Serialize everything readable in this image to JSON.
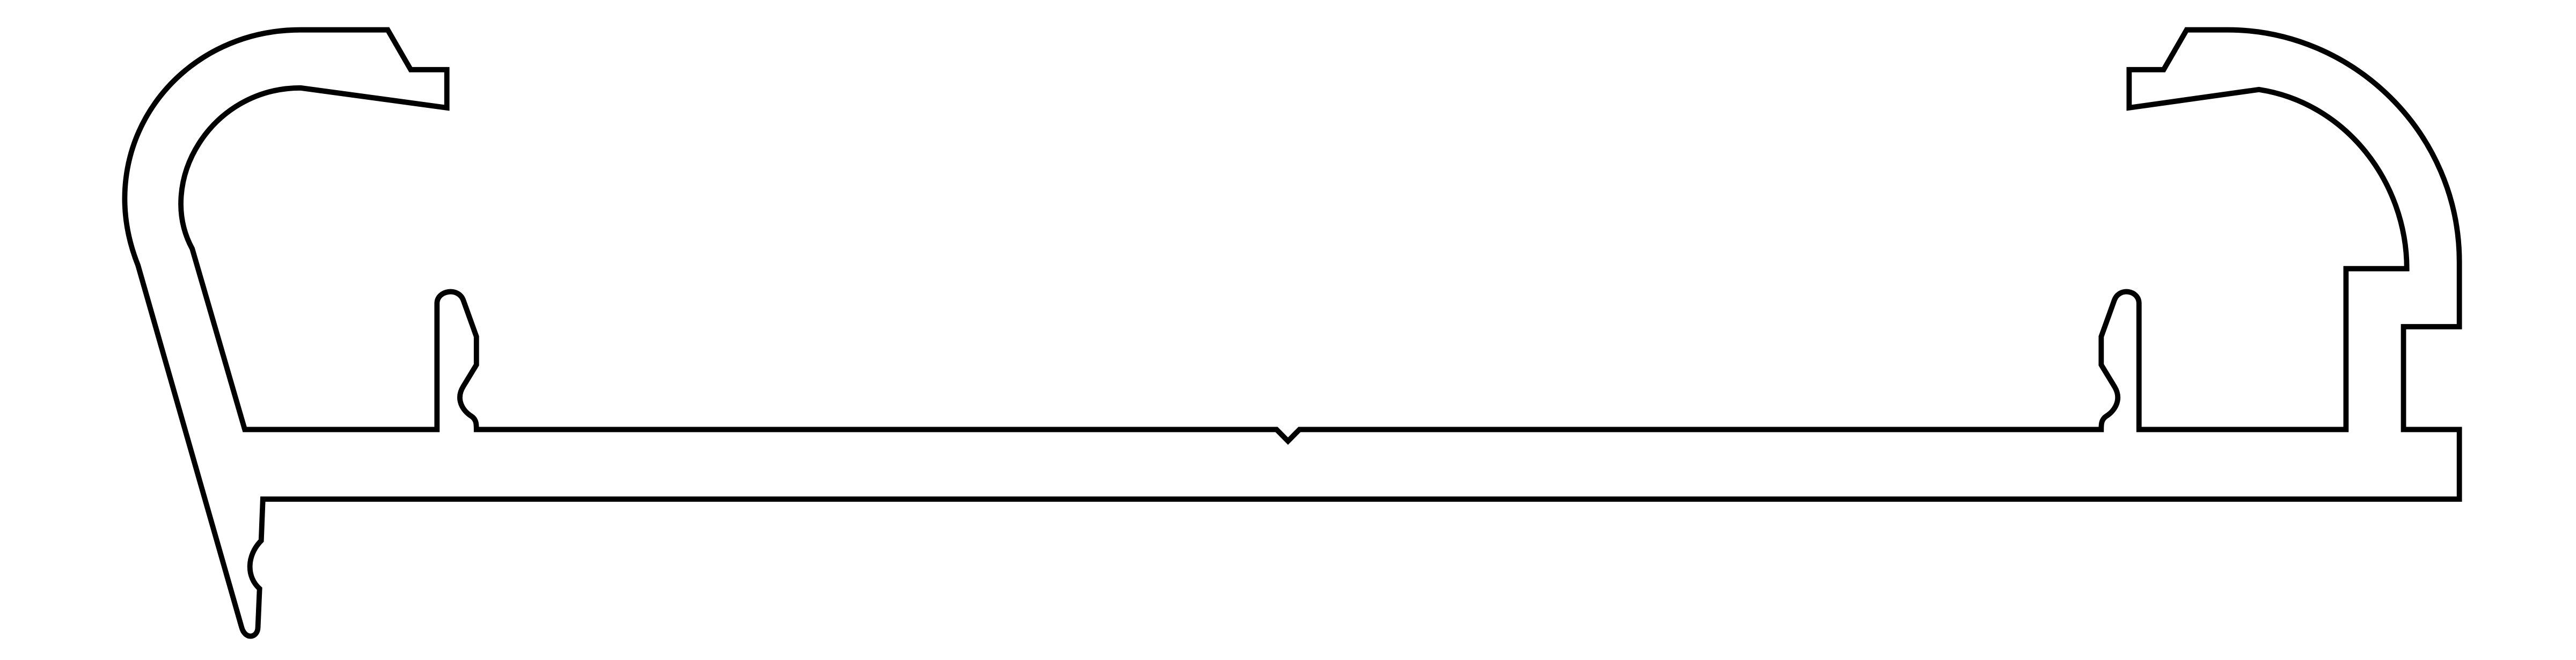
{
  "drawing": {
    "type": "extrusion-profile-cross-section",
    "colors": {
      "background": "#ffffff",
      "line": "#000000"
    },
    "annotations": []
  }
}
